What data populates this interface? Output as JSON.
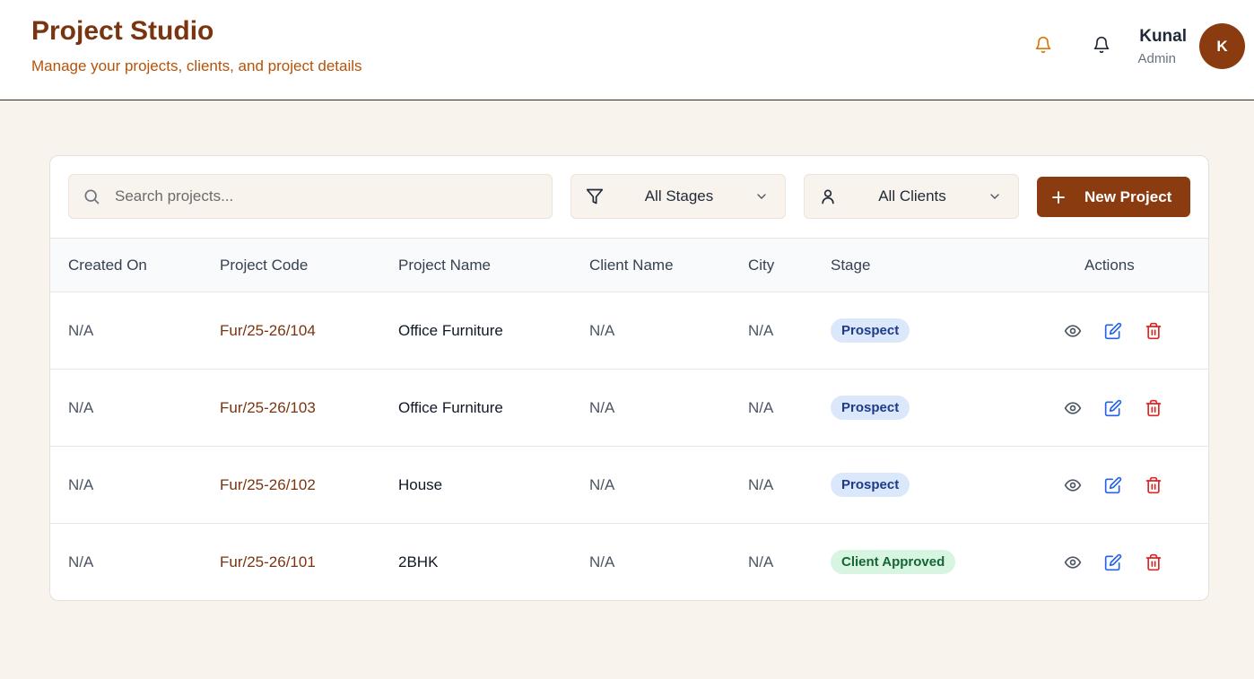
{
  "header": {
    "title": "Project Studio",
    "subtitle": "Manage your projects, clients, and project details",
    "icons": [
      "bell-icon",
      "bell-icon"
    ],
    "user": {
      "name": "Kunal",
      "role": "Admin",
      "initial": "K"
    }
  },
  "toolbar": {
    "search_placeholder": "Search projects...",
    "stage_filter": "All Stages",
    "client_filter": "All Clients",
    "new_project_label": "New Project"
  },
  "table": {
    "columns": [
      "Created On",
      "Project Code",
      "Project Name",
      "Client Name",
      "City",
      "Stage",
      "Actions"
    ],
    "rows": [
      {
        "created_on": "N/A",
        "code": "Fur/25-26/104",
        "name": "Office Furniture",
        "client": "N/A",
        "city": "N/A",
        "stage": "Prospect"
      },
      {
        "created_on": "N/A",
        "code": "Fur/25-26/103",
        "name": "Office Furniture",
        "client": "N/A",
        "city": "N/A",
        "stage": "Prospect"
      },
      {
        "created_on": "N/A",
        "code": "Fur/25-26/102",
        "name": "House",
        "client": "N/A",
        "city": "N/A",
        "stage": "Prospect"
      },
      {
        "created_on": "N/A",
        "code": "Fur/25-26/101",
        "name": "2BHK",
        "client": "N/A",
        "city": "N/A",
        "stage": "Client Approved"
      }
    ]
  },
  "colors": {
    "brand": "#8a3b0f",
    "background": "#f8f3ec",
    "prospect_badge": "#dbe8fb",
    "approved_badge": "#d7f5e1",
    "edit_icon": "#2563eb",
    "delete_icon": "#dc2626",
    "notification_icon": "#d97706"
  }
}
